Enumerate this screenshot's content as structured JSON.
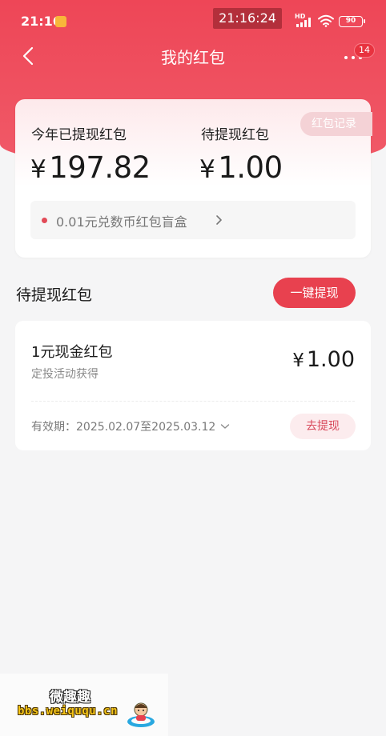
{
  "status_bar": {
    "time": "21:16",
    "center_time": "21:16:24",
    "network": "HD",
    "battery": "90"
  },
  "nav": {
    "title": "我的红包",
    "badge_count": "14"
  },
  "summary": {
    "record_label": "红包记录",
    "withdrawn_label": "今年已提现红包",
    "withdrawn_currency": "¥",
    "withdrawn_amount": "197.82",
    "pending_label": "待提现红包",
    "pending_currency": "¥",
    "pending_amount": "1.00",
    "exchange_text": "0.01元兑数币红包盲盒"
  },
  "pending_section": {
    "title": "待提现红包",
    "withdraw_all_label": "一键提现",
    "items": [
      {
        "name": "1元现金红包",
        "source": "定投活动获得",
        "currency": "¥",
        "amount": "1.00",
        "validity": "有效期：2025.02.07至2025.03.12",
        "action_label": "去提现"
      }
    ]
  },
  "watermark": {
    "title": "微趣趣",
    "url": "bbs.weiququ.cn"
  },
  "colors": {
    "brand_red": "#ee4657",
    "button_red": "#e8414f",
    "light_pink": "#fcecee"
  }
}
